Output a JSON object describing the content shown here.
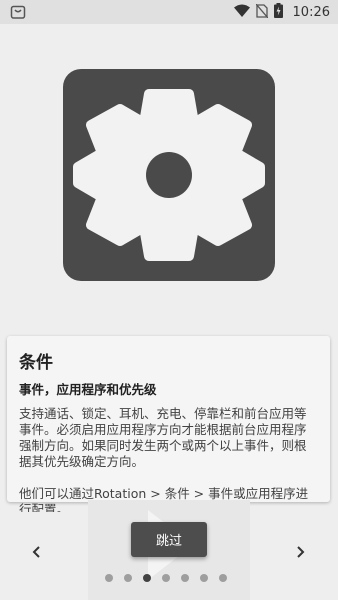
{
  "status_bar": {
    "time": "10:26",
    "icons": [
      "notification-bag-icon",
      "wifi-icon",
      "no-sim-icon",
      "battery-icon"
    ]
  },
  "hero": {
    "icon": "gear-icon",
    "background_color": "#4a4a4a"
  },
  "card": {
    "title": "条件",
    "subtitle": "事件，应用程序和优先级",
    "body": "支持通话、锁定、耳机、充电、停靠栏和前台应用等事件。必须启用应用程序方向才能根据前台应用程序强制方向。如果同时发生两个或两个以上事件，则根据其优先级确定方向。\n\n他们可以通过Rotation > 条件 > 事件或应用程序进行配置。"
  },
  "navigation": {
    "prev_icon": "chevron-left-icon",
    "next_icon": "chevron-right-icon",
    "skip_label": "跳过",
    "page_count": 7,
    "current_page": 3
  }
}
